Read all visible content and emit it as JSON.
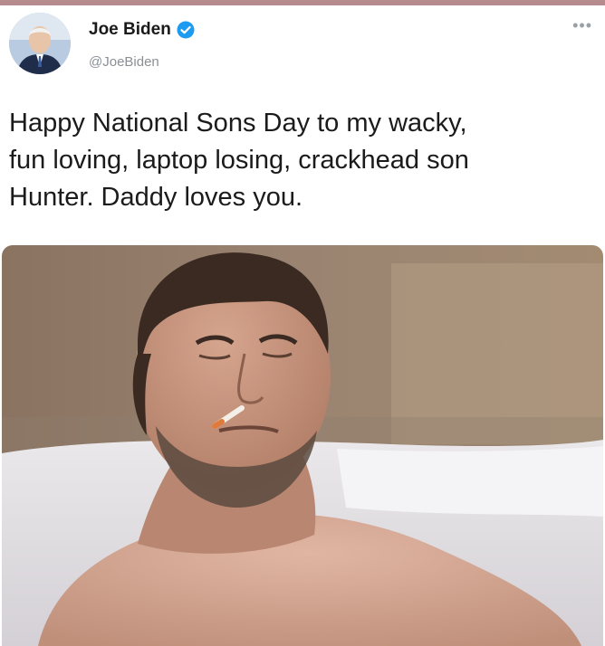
{
  "tweet": {
    "author": {
      "display_name": "Joe Biden",
      "handle": "@JoeBiden",
      "verified": true,
      "avatar_icon": "profile-photo"
    },
    "menu_icon": "more-horizontal-icon",
    "text": "Happy National Sons Day to my wacky,\nfun loving, laptop losing, crackhead son\nHunter. Daddy loves you.",
    "media_description_icon": "attached-photo"
  },
  "colors": {
    "verified_badge": "#1d9bf0",
    "text": "#1b1b1b",
    "handle": "#8a8f96",
    "top_strip": "#b78a8e"
  }
}
